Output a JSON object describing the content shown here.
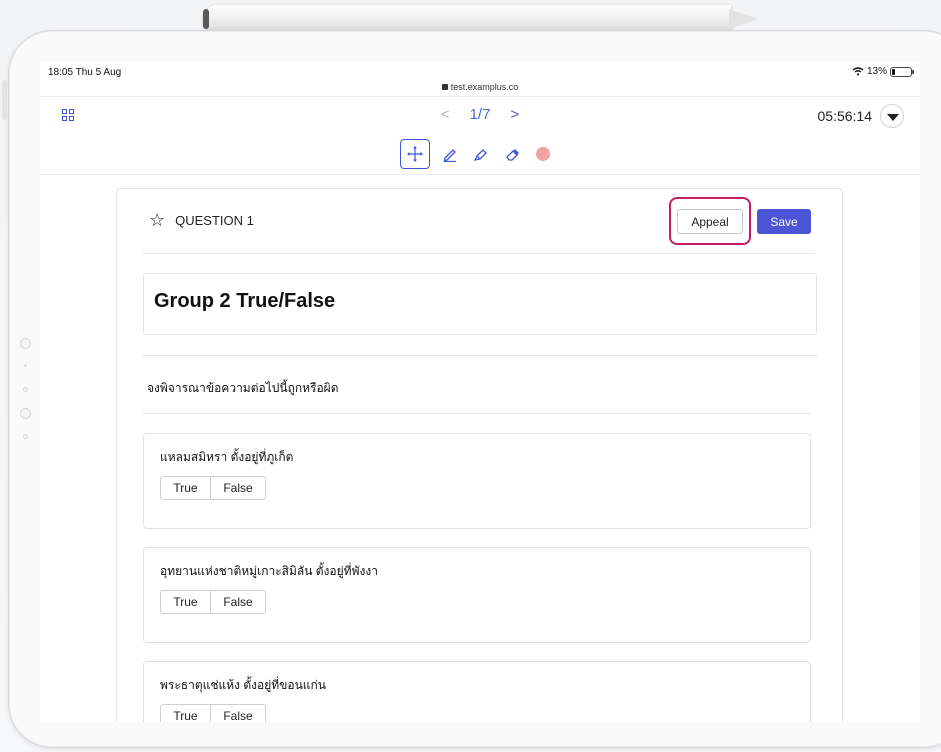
{
  "status_bar": {
    "time": "18:05  Thu 5 Aug",
    "battery": "13%",
    "url": "test.examplus.co"
  },
  "header": {
    "prev": "<",
    "page": "1/7",
    "next": ">",
    "timer": "05:56:14"
  },
  "toolbar": {
    "tools": [
      "move-tool",
      "pen-tool",
      "highlighter-tool",
      "eraser-tool",
      "color-swatch"
    ],
    "swatch_color": "#f2a2a5"
  },
  "question": {
    "label": "QUESTION 1",
    "appeal_label": "Appeal",
    "save_label": "Save",
    "group_title": "Group 2 True/False",
    "instruction": "จงพิจารณาข้อความต่อไปนี้ถูกหรือผิด",
    "items": [
      {
        "statement": "แหลมสมิหรา ตั้งอยู่ที่ภูเก็ต",
        "true_label": "True",
        "false_label": "False"
      },
      {
        "statement": "อุทยานแห่งชาติหมู่เกาะสิมิลัน ตั้งอยู่ที่พังงา",
        "true_label": "True",
        "false_label": "False"
      },
      {
        "statement": "พระธาตุแช่แห้ง ตั้งอยู่ที่ขอนแก่น",
        "true_label": "True",
        "false_label": "False"
      }
    ]
  },
  "colors": {
    "accent": "#4b55d6",
    "highlight": "#c41d6a"
  }
}
